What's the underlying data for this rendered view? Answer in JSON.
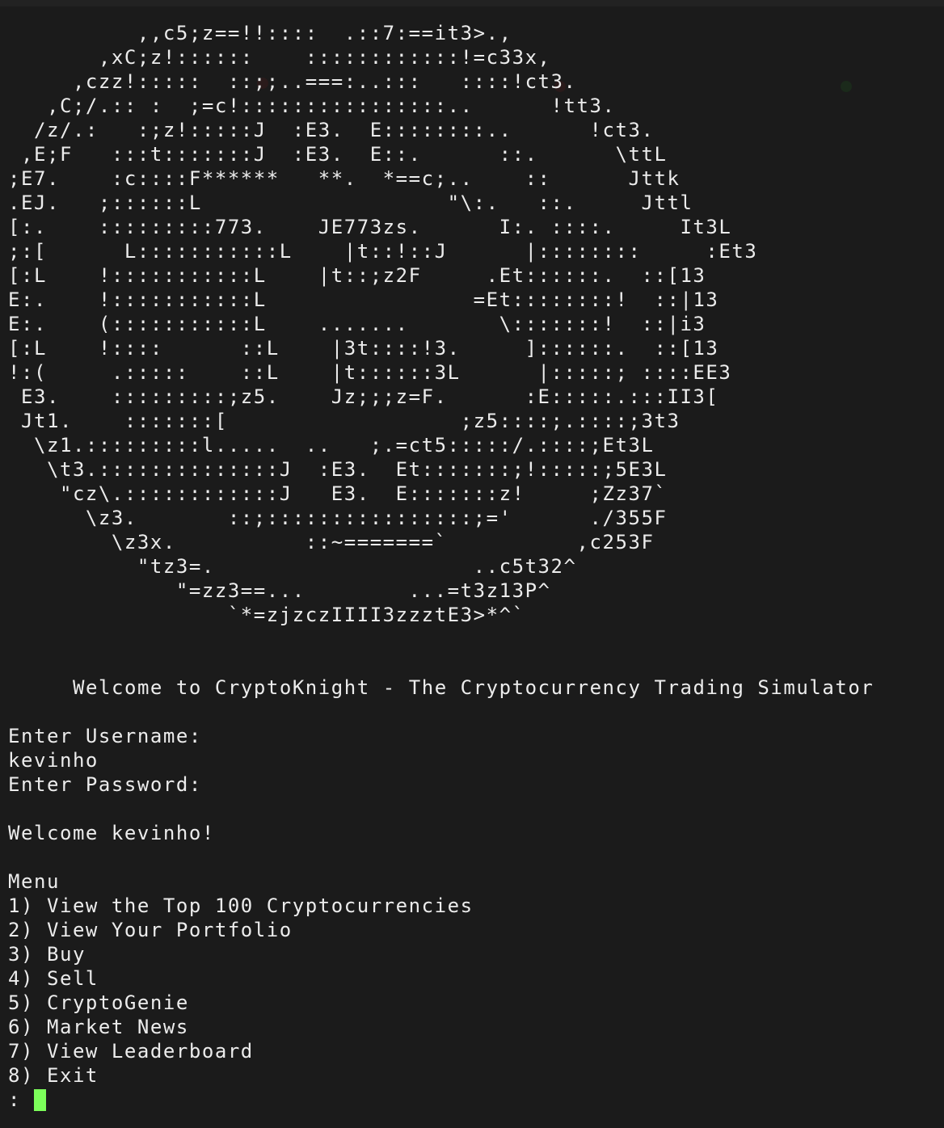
{
  "ascii_logo": [
    "          ,,c5;z==!!::::  .::7:==it3>.,",
    "       ,xC;z!::::::    ::::::::::::!=c33x,",
    "     ,czz!:::::  ::;;..===:..:::   ::::!ct3.",
    "   ,C;/.:: :  ;=c!::::::::::::::::..      !tt3.",
    "  /z/.:   :;z!:::::J  :E3.  E::::::::..      !ct3.",
    " ,E;F   :::t:::::::J  :E3.  E::.      ::.      \\ttL",
    ";E7.    :c::::F******   **.  *==c;..    ::      Jttk",
    ".EJ.   ;::::::L                   \"\\:.   ::.     Jttl",
    "[:.    :::::::::773.    JE773zs.      I:. ::::.     It3L",
    ";:[      L:::::::::::L    |t::!::J      |::::::::     :Et3",
    "[:L    !:::::::::::L    |t::;z2F     .Et::::::.  ::[13",
    "E:.    !:::::::::::L                =Et::::::::!  ::|13",
    "E:.    (:::::::::::L    .......       \\:::::::!  ::|i3",
    "[:L    !::::      ::L    |3t::::!3.     ]::::::.  ::[13",
    "!:(     .:::::    ::L    |t::::::3L      |:::::; ::::EE3",
    " E3.    :::::::::;z5.    Jz;;;z=F.      :E:::::.:::II3[",
    " Jt1.    :::::::[                  ;z5::::;.::::;3t3",
    "  \\z1.:::::::::l.....  ..   ;.=ct5:::::/.::::;Et3L",
    "   \\t3.::::::::::::::J  :E3.  Et:::::::;!:::::;5E3L",
    "    \"cz\\.::::::::::::J   E3.  E:::::::z!     ;Zz37`",
    "      \\z3.       ::;::::::::::::::::;='      ./355F",
    "        \\z3x.          ::~=======`          ,c253F",
    "          \"tz3=.                    ..c5t32^",
    "             \"=zz3==...        ...=t3z13P^",
    "                 `*=zjzczIIII3zzztE3>*^`"
  ],
  "welcome_banner": "Welcome to CryptoKnight - The Cryptocurrency Trading Simulator",
  "login": {
    "username_prompt": "Enter Username:",
    "username_value": "kevinho",
    "password_prompt": "Enter Password:"
  },
  "greeting": "Welcome kevinho!",
  "menu": {
    "title": "Menu",
    "items": [
      "1) View the Top 100 Cryptocurrencies",
      "2) View Your Portfolio",
      "3) Buy",
      "4) Sell",
      "5) CryptoGenie",
      "6) Market News",
      "7) View Leaderboard",
      "8) Exit"
    ]
  },
  "input_prompt": ":",
  "colors": {
    "background": "#1b1b1b",
    "text": "#ececec",
    "cursor": "#7cff5a"
  }
}
